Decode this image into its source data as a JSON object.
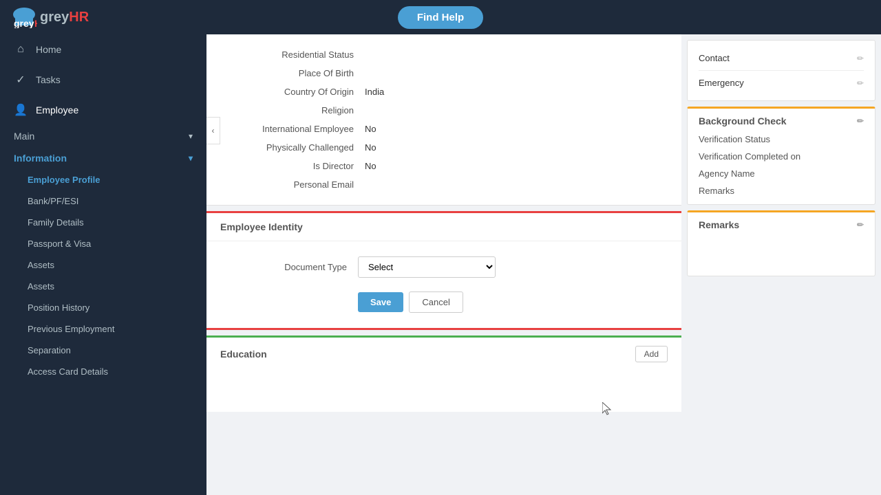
{
  "topbar": {
    "find_help_label": "Find Help",
    "logo_grey": "grey",
    "logo_hr": "HR"
  },
  "sidebar": {
    "nav_items": [
      {
        "id": "home",
        "label": "Home",
        "icon": "⌂",
        "active": false
      },
      {
        "id": "tasks",
        "label": "Tasks",
        "icon": "✓",
        "active": false
      },
      {
        "id": "employee",
        "label": "Employee",
        "icon": "👤",
        "active": true
      }
    ],
    "sections": [
      {
        "id": "main",
        "label": "Main",
        "expanded": true
      },
      {
        "id": "information",
        "label": "Information",
        "expanded": true,
        "active": true
      }
    ],
    "sub_items": [
      {
        "id": "employee-profile",
        "label": "Employee Profile",
        "active": true
      },
      {
        "id": "bank-pf-esi",
        "label": "Bank/PF/ESI",
        "active": false
      },
      {
        "id": "family-details",
        "label": "Family Details",
        "active": false
      },
      {
        "id": "passport-visa",
        "label": "Passport & Visa",
        "active": false
      },
      {
        "id": "assets-header",
        "label": "Assets",
        "active": false
      },
      {
        "id": "assets",
        "label": "Assets",
        "active": false
      },
      {
        "id": "position-history",
        "label": "Position History",
        "active": false
      },
      {
        "id": "previous-employment",
        "label": "Previous Employment",
        "active": false
      },
      {
        "id": "separation",
        "label": "Separation",
        "active": false
      },
      {
        "id": "access-card-details",
        "label": "Access Card Details",
        "active": false
      }
    ]
  },
  "form_fields": [
    {
      "label": "Residential Status",
      "value": ""
    },
    {
      "label": "Place Of Birth",
      "value": ""
    },
    {
      "label": "Country Of Origin",
      "value": "India"
    },
    {
      "label": "Religion",
      "value": ""
    },
    {
      "label": "International Employee",
      "value": "No"
    },
    {
      "label": "Physically Challenged",
      "value": "No"
    },
    {
      "label": "Is Director",
      "value": "No"
    },
    {
      "label": "Personal Email",
      "value": ""
    }
  ],
  "employee_identity": {
    "title": "Employee Identity",
    "document_type_label": "Document Type",
    "select_placeholder": "Select",
    "save_label": "Save",
    "cancel_label": "Cancel"
  },
  "education": {
    "title": "Education",
    "add_label": "Add"
  },
  "right_panel": {
    "contact_label": "Contact",
    "emergency_label": "Emergency",
    "background_check": {
      "title": "Background Check",
      "fields": [
        "Verification Status",
        "Verification Completed on",
        "Agency Name",
        "Remarks"
      ]
    },
    "remarks": {
      "title": "Remarks"
    }
  }
}
